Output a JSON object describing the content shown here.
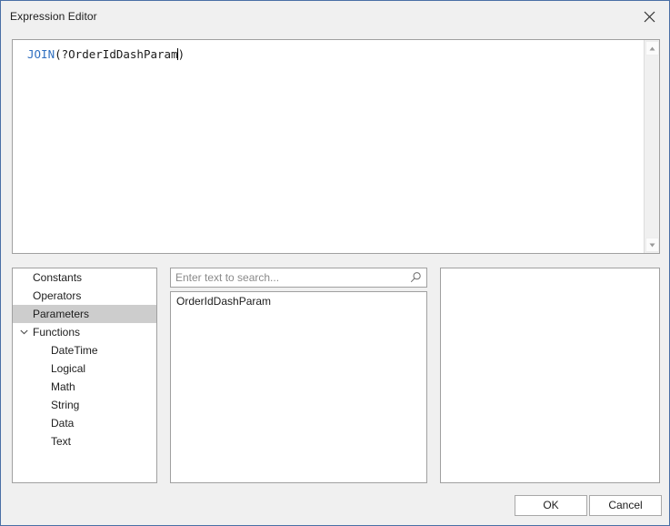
{
  "window": {
    "title": "Expression Editor",
    "close_icon": "close-icon",
    "border_color": "#4a6fa5",
    "background": "#f0f0f0"
  },
  "editor": {
    "expression_tokens": [
      {
        "text": "JOIN",
        "kind": "function",
        "color": "#2f6fc0"
      },
      {
        "text": "(?OrderIdDashParam",
        "kind": "plain",
        "color": "#1a1a1a"
      },
      {
        "text": ")",
        "kind": "plain",
        "color": "#1a1a1a"
      }
    ],
    "expression_full": "JOIN(?OrderIdDashParam)",
    "caret_after": "JOIN(?OrderIdDashParam",
    "scrollbar": {
      "up_icon": "triangle-up-icon",
      "down_icon": "triangle-down-icon"
    }
  },
  "tree": {
    "items": [
      {
        "label": "Constants",
        "level": 0,
        "selected": false,
        "expandable": false
      },
      {
        "label": "Operators",
        "level": 0,
        "selected": false,
        "expandable": false
      },
      {
        "label": "Parameters",
        "level": 0,
        "selected": true,
        "expandable": false
      },
      {
        "label": "Functions",
        "level": 0,
        "selected": false,
        "expandable": true,
        "expanded": true,
        "chevron": "chevron-down-icon"
      },
      {
        "label": "DateTime",
        "level": 1,
        "selected": false,
        "expandable": false
      },
      {
        "label": "Logical",
        "level": 1,
        "selected": false,
        "expandable": false
      },
      {
        "label": "Math",
        "level": 1,
        "selected": false,
        "expandable": false
      },
      {
        "label": "String",
        "level": 1,
        "selected": false,
        "expandable": false
      },
      {
        "label": "Data",
        "level": 1,
        "selected": false,
        "expandable": false
      },
      {
        "label": "Text",
        "level": 1,
        "selected": false,
        "expandable": false
      }
    ]
  },
  "search": {
    "placeholder": "Enter text to search...",
    "value": "",
    "icon": "search-icon"
  },
  "item_list": {
    "items": [
      {
        "label": "OrderIdDashParam",
        "selected": false
      }
    ]
  },
  "detail": {
    "text": ""
  },
  "footer": {
    "ok_label": "OK",
    "cancel_label": "Cancel"
  }
}
